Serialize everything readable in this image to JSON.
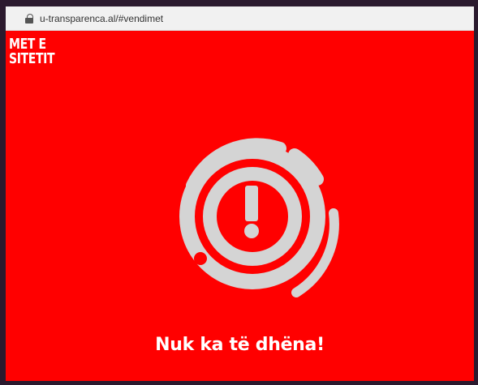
{
  "browser": {
    "url": "u-transparenca.al/#vendimet",
    "lock_icon": "lock-icon"
  },
  "header": {
    "brand_line1": "MET E",
    "brand_line2": "SITETIT"
  },
  "empty_state": {
    "icon": "no-data-warning-icon",
    "message": "Nuk ka të dhëna!"
  },
  "colors": {
    "background": "#ff0000",
    "icon": "#d4d4d4",
    "text": "#ffffff"
  }
}
